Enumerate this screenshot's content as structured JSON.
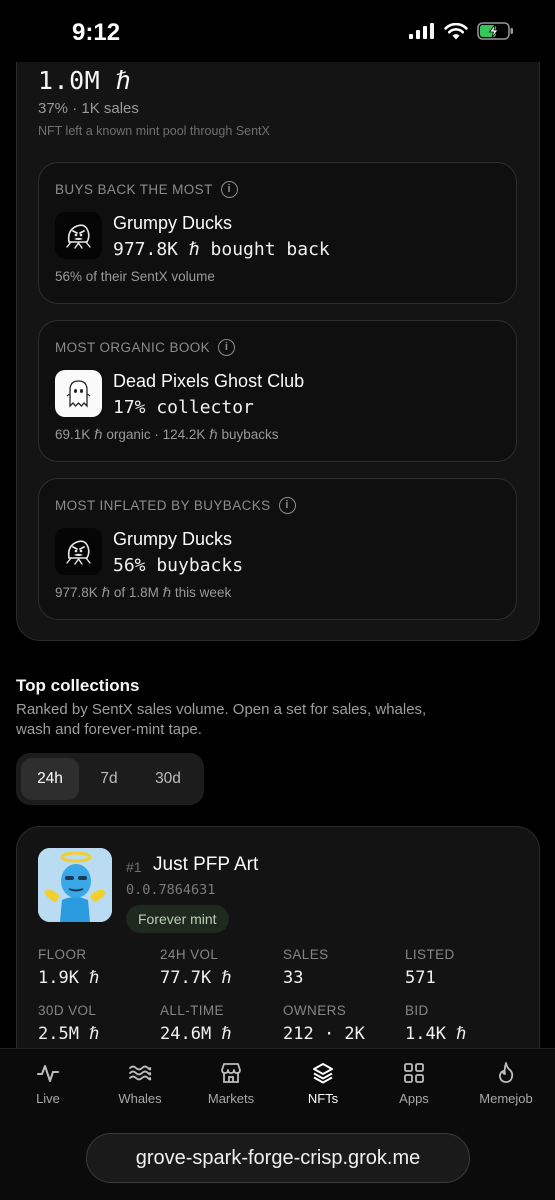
{
  "status": {
    "time": "9:12"
  },
  "summary": {
    "value": "1.0M ℏ",
    "line1": "37% · 1K sales",
    "line2": "NFT left a known mint pool through SentX",
    "cards": [
      {
        "label": "BUYS BACK THE MOST",
        "name": "Grumpy Ducks",
        "stat": "977.8K ℏ bought back",
        "foot": "56% of their SentX volume",
        "icon": "grumpy-duck-icon"
      },
      {
        "label": "MOST ORGANIC BOOK",
        "name": "Dead Pixels Ghost Club",
        "stat": "17% collector",
        "foot": "69.1K ℏ organic · 124.2K ℏ buybacks",
        "icon": "ghost-icon"
      },
      {
        "label": "MOST INFLATED BY BUYBACKS",
        "name": "Grumpy Ducks",
        "stat": "56% buybacks",
        "foot": "977.8K ℏ of 1.8M ℏ this week",
        "icon": "grumpy-duck-icon"
      }
    ]
  },
  "top": {
    "title": "Top collections",
    "desc": "Ranked by SentX sales volume. Open a set for sales, whales, wash and forever-mint tape.",
    "tabs": [
      "24h",
      "7d",
      "30d"
    ],
    "active_tab": "24h"
  },
  "collection": {
    "rank": "#1",
    "name": "Just PFP Art",
    "id": "0.0.7864631",
    "badge": "Forever mint",
    "metrics": [
      {
        "k": "FLOOR",
        "v": "1.9K ℏ"
      },
      {
        "k": "24H VOL",
        "v": "77.7K ℏ"
      },
      {
        "k": "SALES",
        "v": "33"
      },
      {
        "k": "LISTED",
        "v": "571"
      },
      {
        "k": "30D VOL",
        "v": "2.5M ℏ"
      },
      {
        "k": "ALL-TIME",
        "v": "24.6M ℏ"
      },
      {
        "k": "OWNERS",
        "v": "212 · 2K"
      },
      {
        "k": "BID",
        "v": "1.4K ℏ"
      }
    ]
  },
  "nav": {
    "items": [
      {
        "label": "Live",
        "icon": "pulse-icon"
      },
      {
        "label": "Whales",
        "icon": "waves-icon"
      },
      {
        "label": "Markets",
        "icon": "store-icon"
      },
      {
        "label": "NFTs",
        "icon": "layers-icon"
      },
      {
        "label": "Apps",
        "icon": "grid-icon"
      },
      {
        "label": "Memejob",
        "icon": "flame-icon"
      }
    ],
    "active": "NFTs"
  },
  "browser": {
    "url": "grove-spark-forge-crisp.grok.me"
  }
}
